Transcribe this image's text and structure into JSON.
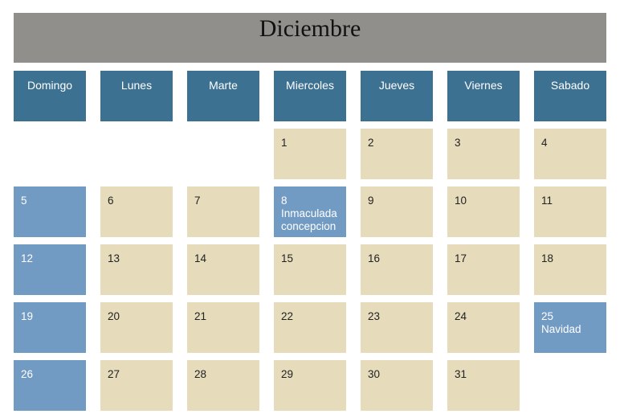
{
  "calendar": {
    "month": "Diciembre",
    "weekdays": [
      "Domingo",
      "Lunes",
      "Marte",
      "Miercoles",
      "Jueves",
      "Viernes",
      "Sabado"
    ],
    "days": [
      {
        "n": "1",
        "note": ""
      },
      {
        "n": "2",
        "note": ""
      },
      {
        "n": "3",
        "note": ""
      },
      {
        "n": "4",
        "note": ""
      },
      {
        "n": "5",
        "note": ""
      },
      {
        "n": "6",
        "note": ""
      },
      {
        "n": "7",
        "note": ""
      },
      {
        "n": "8",
        "note": "Inmaculada concepcion"
      },
      {
        "n": "9",
        "note": ""
      },
      {
        "n": "10",
        "note": ""
      },
      {
        "n": "11",
        "note": ""
      },
      {
        "n": "12",
        "note": ""
      },
      {
        "n": "13",
        "note": ""
      },
      {
        "n": "14",
        "note": ""
      },
      {
        "n": "15",
        "note": ""
      },
      {
        "n": "16",
        "note": ""
      },
      {
        "n": "17",
        "note": ""
      },
      {
        "n": "18",
        "note": ""
      },
      {
        "n": "19",
        "note": ""
      },
      {
        "n": "20",
        "note": ""
      },
      {
        "n": "21",
        "note": ""
      },
      {
        "n": "22",
        "note": ""
      },
      {
        "n": "23",
        "note": ""
      },
      {
        "n": "24",
        "note": ""
      },
      {
        "n": "25",
        "note": "Navidad"
      },
      {
        "n": "26",
        "note": ""
      },
      {
        "n": "27",
        "note": ""
      },
      {
        "n": "28",
        "note": ""
      },
      {
        "n": "29",
        "note": ""
      },
      {
        "n": "30",
        "note": ""
      },
      {
        "n": "31",
        "note": ""
      }
    ]
  },
  "colors": {
    "title_bg": "#908f8c",
    "header_bg": "#3d7191",
    "day_bg": "#e6dcbb",
    "highlight_bg": "#729bc3"
  }
}
